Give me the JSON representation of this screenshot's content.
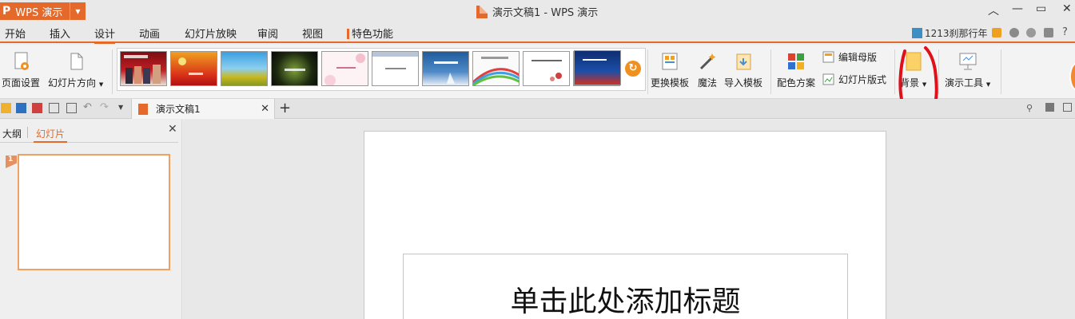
{
  "app": {
    "name": "WPS 演示",
    "window_title": "演示文稿1 - WPS 演示"
  },
  "menu": {
    "items": [
      "开始",
      "插入",
      "设计",
      "动画",
      "幻灯片放映",
      "审阅",
      "视图"
    ],
    "special": "特色功能",
    "active": "设计",
    "account": "1213刹那行年",
    "help": "?"
  },
  "ribbon": {
    "page_setup": "页面设置",
    "slide_orientation": "幻灯片方向",
    "change_template": "更换模板",
    "magic": "魔法",
    "import_template": "导入模板",
    "color_scheme": "配色方案",
    "edit_master": "编辑母版",
    "slide_layout": "幻灯片版式",
    "background": "背景",
    "presentation_tools": "演示工具",
    "template_count": 10
  },
  "doc_tab": {
    "title": "演示文稿1"
  },
  "panel": {
    "outline_tab": "大纲",
    "slides_tab": "幻灯片",
    "slide_number": "1"
  },
  "slide": {
    "title_placeholder": "单击此处添加标题"
  },
  "colors": {
    "accent": "#e4692a",
    "annotation": "#e0101a"
  }
}
